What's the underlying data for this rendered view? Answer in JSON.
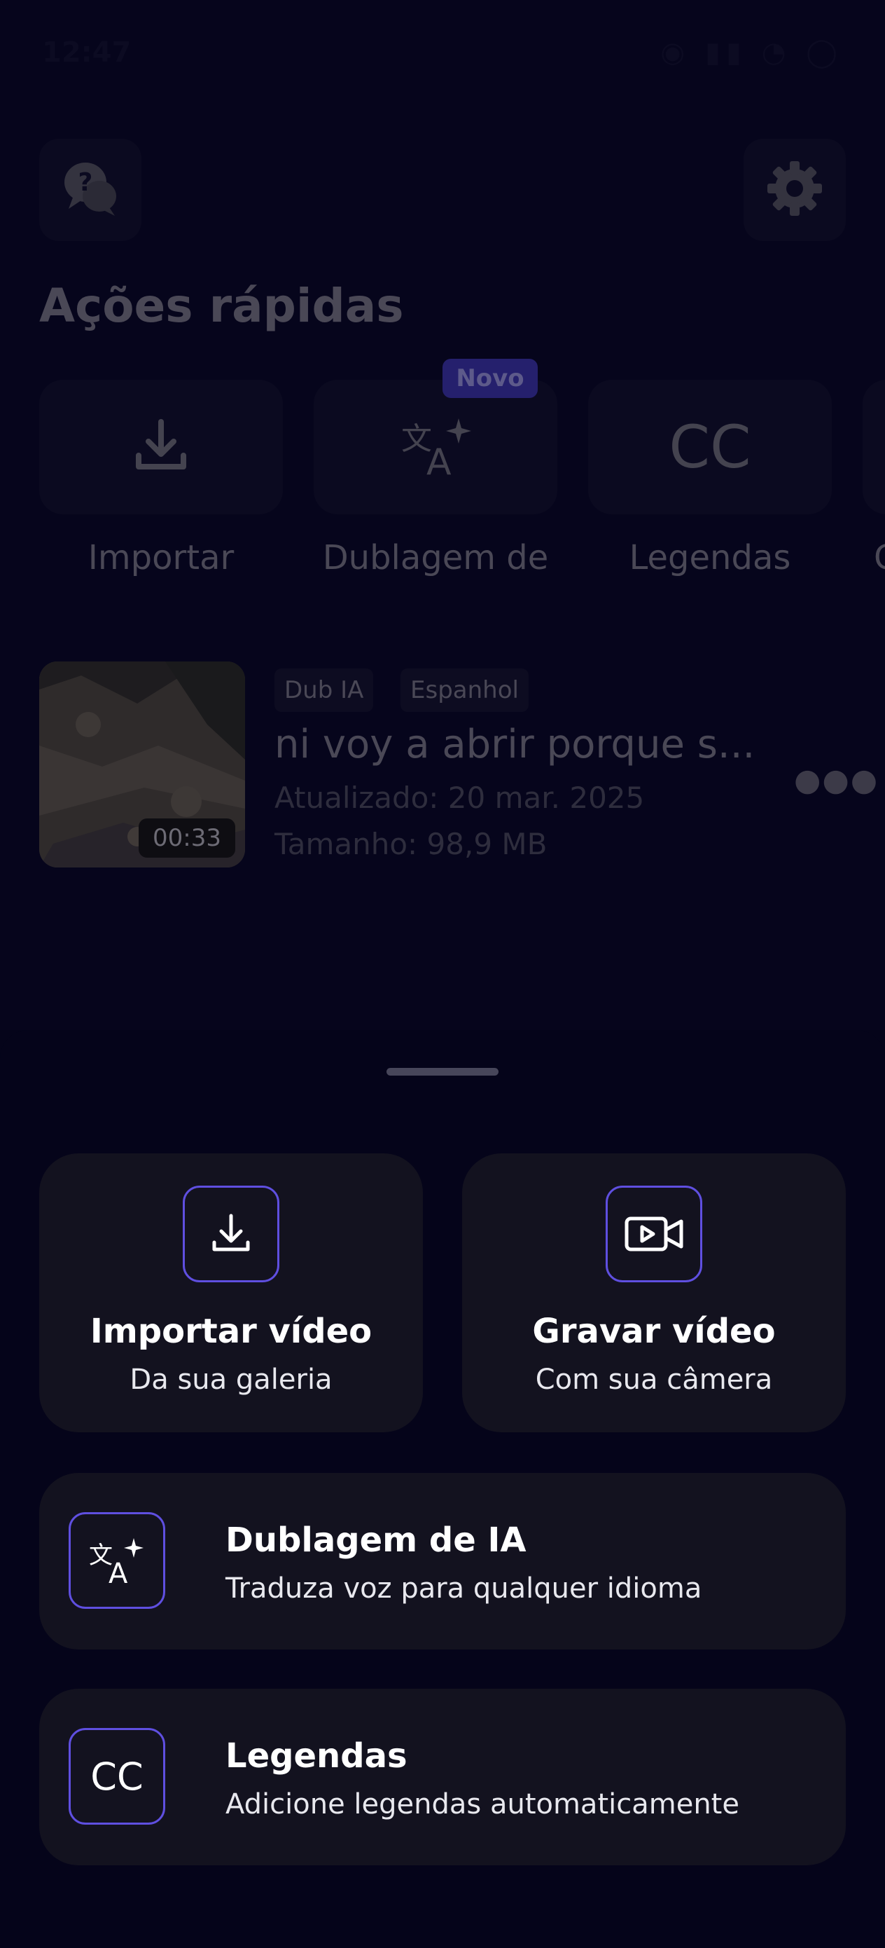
{
  "status_bar": {
    "time": "12:47",
    "icons": "◉ ▮▮ ◔ ◯"
  },
  "header": {
    "help_icon": "help-chat-icon",
    "settings_icon": "gear-icon"
  },
  "quick_actions": {
    "title": "Ações rápidas",
    "badge": "Novo",
    "items": [
      {
        "label": "Importar",
        "icon": "download-icon"
      },
      {
        "label": "Dublagem de",
        "icon": "translate-sparkle-icon"
      },
      {
        "label": "Legendas",
        "icon": "cc-icon",
        "icon_text": "CC"
      },
      {
        "label": "G",
        "icon": "more-icon"
      }
    ]
  },
  "project": {
    "duration": "00:33",
    "tags": [
      "Dub IA",
      "Espanhol"
    ],
    "title": "ni voy a abrir porque s...",
    "updated": "Atualizado: 20 mar. 2025",
    "size": "Tamanho: 98,9 MB",
    "more_icon": "more-horizontal-icon"
  },
  "sheet": {
    "import": {
      "title": "Importar vídeo",
      "subtitle": "Da sua galeria",
      "icon": "download-icon"
    },
    "record": {
      "title": "Gravar vídeo",
      "subtitle": "Com sua câmera",
      "icon": "video-camera-icon"
    },
    "dub": {
      "title": "Dublagem de IA",
      "subtitle": "Traduza voz para qualquer idioma",
      "icon": "translate-sparkle-icon"
    },
    "captions": {
      "title": "Legendas",
      "subtitle": "Adicione legendas automaticamente",
      "icon": "cc-icon",
      "icon_text": "CC"
    }
  },
  "colors": {
    "accent": "#5f4fe0",
    "card": "#13121f",
    "background": "#05041a"
  }
}
